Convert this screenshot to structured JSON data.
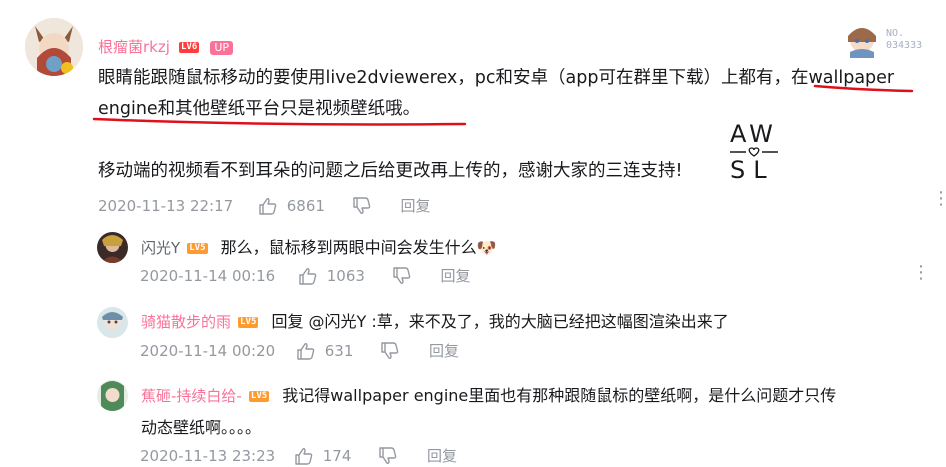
{
  "main_comment": {
    "username": "根瘤菌rkzj",
    "level": "LV6",
    "up_badge": "UP",
    "line1_a": "眼睛能跟随鼠标移动的要使用live2dviewerex，pc和安卓（app可在群里下载）上都有，",
    "line1_b": "在wallpaper",
    "line2": "engine和其他壁纸平台只是视频壁纸哦。",
    "line3": "移动端的视频看不到耳朵的问题之后给更改再上传的，感谢大家的三连支持!",
    "sticker_line1": "AW",
    "sticker_line2": "SL",
    "date": "2020-11-13 22:17",
    "likes": "6861",
    "reply_label": "回复"
  },
  "fan_medal": {
    "text": "NO.\n034333"
  },
  "replies": [
    {
      "username": "闪光Y",
      "level": "LV5",
      "text": "那么，鼠标移到两眼中间会发生什么🐶",
      "date": "2020-11-14 00:16",
      "likes": "1063",
      "reply_label": "回复"
    },
    {
      "username": "骑猫散步的雨",
      "level": "LV5",
      "text": "回复 @闪光Y :草，来不及了，我的大脑已经把这幅图渲染出来了",
      "date": "2020-11-14 00:20",
      "likes": "631",
      "reply_label": "回复"
    },
    {
      "username": "蕉砸-持续白给-",
      "level": "LV5",
      "text_line1": "我记得wallpaper engine里面也有那种跟随鼠标的壁纸啊，是什么问题才只传",
      "text_line2": "动态壁纸啊。。。。",
      "date": "2020-11-13 23:23",
      "likes": "174",
      "reply_label": "回复"
    }
  ],
  "colors": {
    "username_pink": "#fb7299",
    "text": "#18191c",
    "meta_gray": "#9499a0",
    "annotation_red": "#e0101a"
  }
}
